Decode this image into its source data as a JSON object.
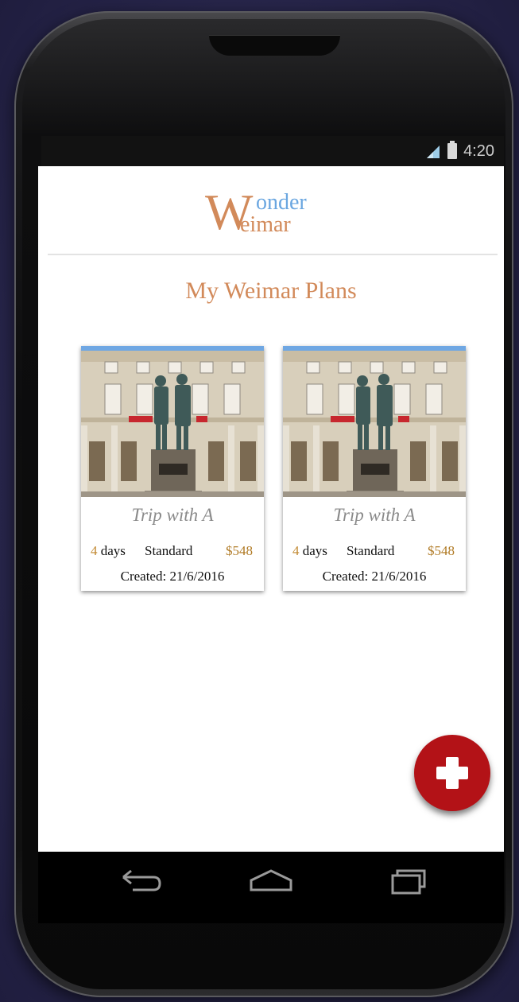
{
  "status_bar": {
    "time": "4:20",
    "signal_icon": "signal-icon",
    "battery_icon": "battery-icon"
  },
  "app": {
    "logo": {
      "w": "W",
      "top": "onder",
      "bottom": "eimar"
    },
    "page_title": "My Weimar Plans"
  },
  "cards": [
    {
      "title": "Trip with A",
      "days_num": "4",
      "days_label": "days",
      "type": "Standard",
      "price": "$548",
      "created": "Created: 21/6/2016"
    },
    {
      "title": "Trip with A",
      "days_num": "4",
      "days_label": "days",
      "type": "Standard",
      "price": "$548",
      "created": "Created: 21/6/2016"
    }
  ],
  "fab": {
    "icon": "plus-icon",
    "color": "#b31217"
  },
  "nav": {
    "back": "back-icon",
    "home": "home-icon",
    "recents": "recents-icon"
  },
  "colors": {
    "accent": "#d28a5a",
    "logo_blue": "#6aa6e0",
    "price": "#b07a24"
  }
}
